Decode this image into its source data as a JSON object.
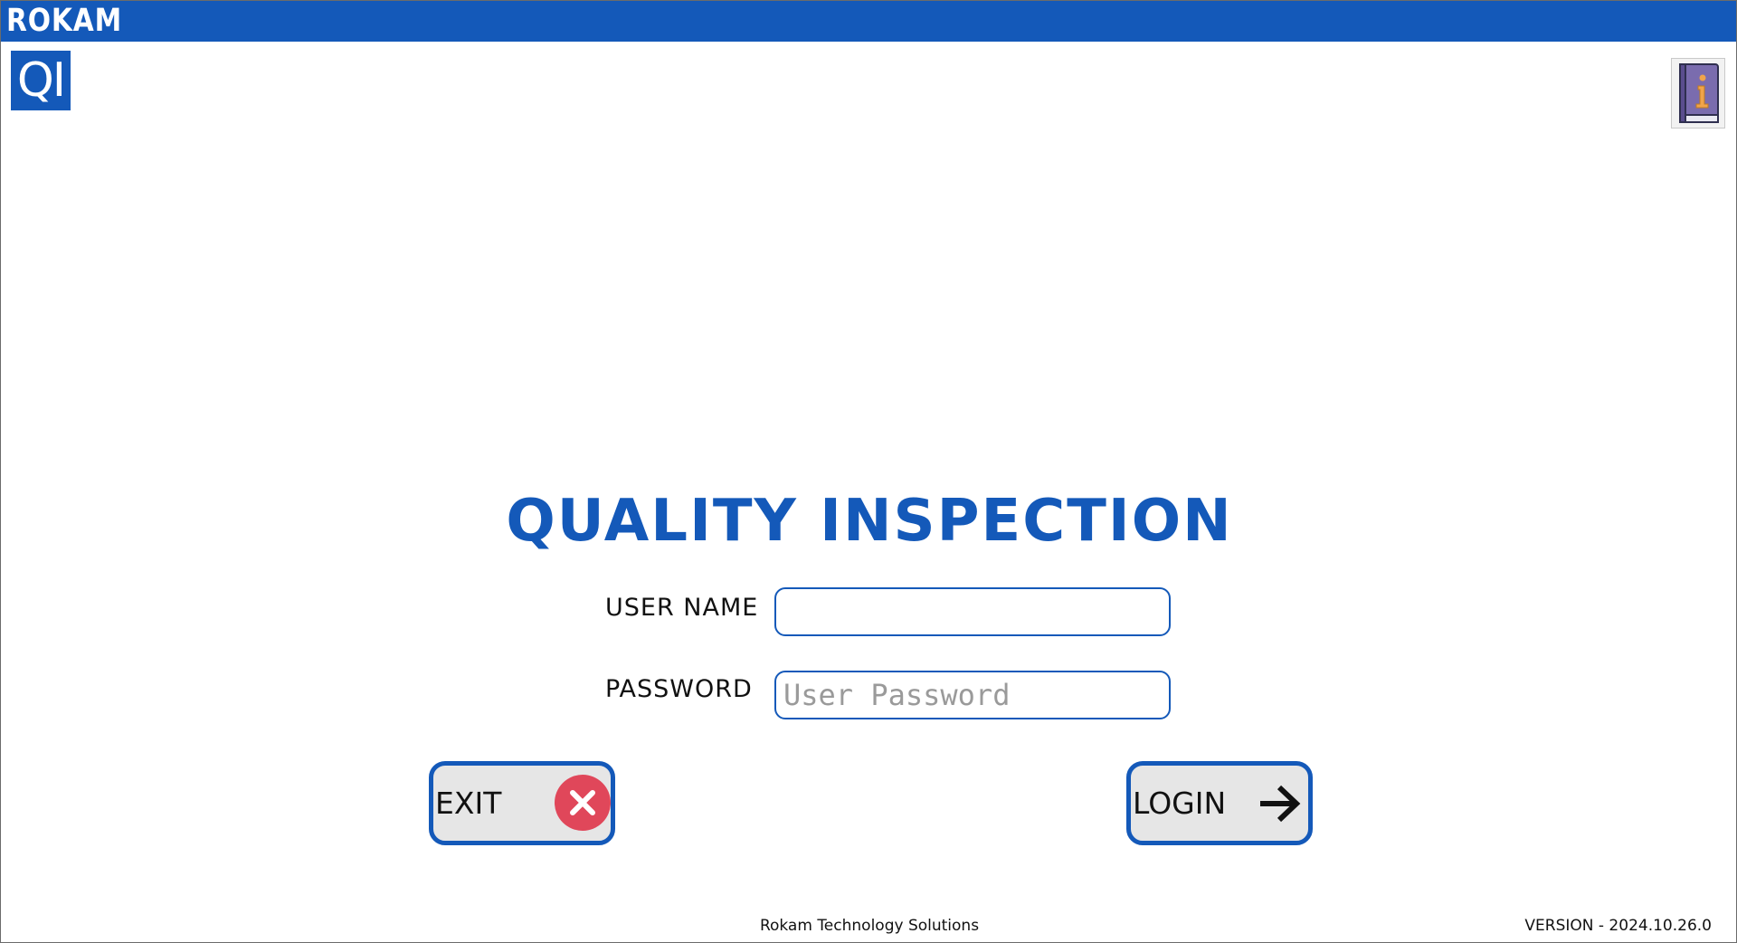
{
  "titlebar": {
    "brand": "ROKAM"
  },
  "logo": {
    "text": "QI"
  },
  "info": {
    "icon": "info-book-icon"
  },
  "login": {
    "title": "QUALITY INSPECTION",
    "username_label": "USER NAME",
    "username_value": "",
    "password_label": "PASSWORD",
    "password_placeholder": "User Password"
  },
  "buttons": {
    "exit_label": "EXIT",
    "exit_icon": "close-circle-icon",
    "login_label": "LOGIN",
    "login_icon": "arrow-right-icon"
  },
  "footer": {
    "company": "Rokam Technology Solutions",
    "version": "VERSION - 2024.10.26.0"
  },
  "colors": {
    "brand_blue": "#1459b9",
    "exit_red": "#e0475a",
    "button_bg": "#e6e6e6"
  }
}
